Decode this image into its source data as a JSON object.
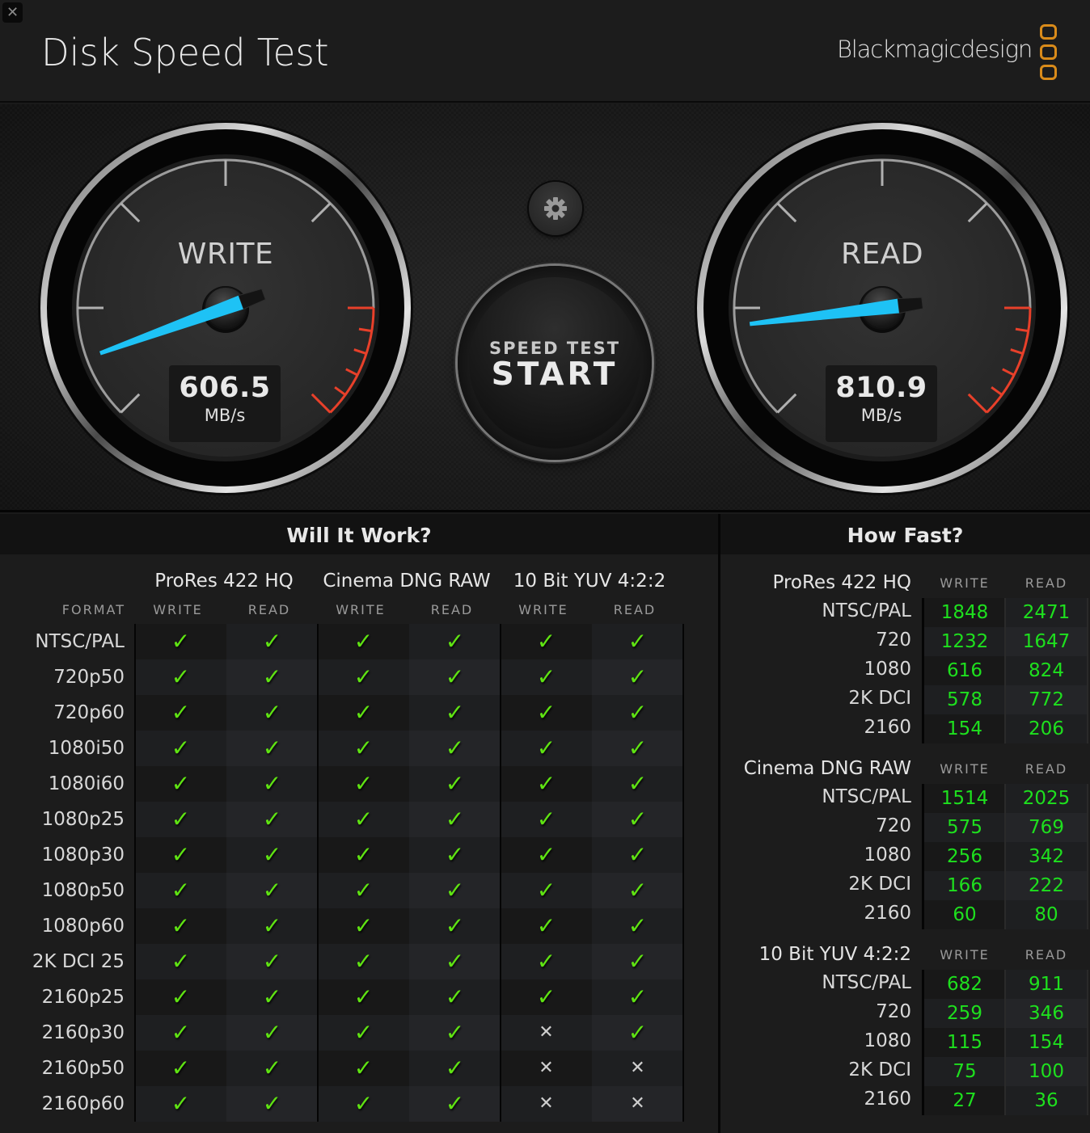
{
  "window": {
    "close_icon": "✕"
  },
  "header": {
    "title": "Disk Speed Test",
    "brand": "Blackmagicdesign"
  },
  "gauges": {
    "write": {
      "label": "WRITE",
      "value": "606.5",
      "unit": "MB/s",
      "needle_fraction": 0.2
    },
    "read": {
      "label": "READ",
      "value": "810.9",
      "unit": "MB/s",
      "needle_fraction": 0.235
    }
  },
  "controls": {
    "settings_icon": "gear-icon",
    "start_line1": "SPEED TEST",
    "start_line2": "START"
  },
  "will_it_work": {
    "title": "Will It Work?",
    "format_header": "FORMAT",
    "codecs": [
      "ProRes 422 HQ",
      "Cinema DNG RAW",
      "10 Bit YUV 4:2:2"
    ],
    "col_labels": [
      "WRITE",
      "READ",
      "WRITE",
      "READ",
      "WRITE",
      "READ"
    ],
    "rows": [
      {
        "format": "NTSC/PAL",
        "results": [
          true,
          true,
          true,
          true,
          true,
          true
        ]
      },
      {
        "format": "720p50",
        "results": [
          true,
          true,
          true,
          true,
          true,
          true
        ]
      },
      {
        "format": "720p60",
        "results": [
          true,
          true,
          true,
          true,
          true,
          true
        ]
      },
      {
        "format": "1080i50",
        "results": [
          true,
          true,
          true,
          true,
          true,
          true
        ]
      },
      {
        "format": "1080i60",
        "results": [
          true,
          true,
          true,
          true,
          true,
          true
        ]
      },
      {
        "format": "1080p25",
        "results": [
          true,
          true,
          true,
          true,
          true,
          true
        ]
      },
      {
        "format": "1080p30",
        "results": [
          true,
          true,
          true,
          true,
          true,
          true
        ]
      },
      {
        "format": "1080p50",
        "results": [
          true,
          true,
          true,
          true,
          true,
          true
        ]
      },
      {
        "format": "1080p60",
        "results": [
          true,
          true,
          true,
          true,
          true,
          true
        ]
      },
      {
        "format": "2K DCI 25",
        "results": [
          true,
          true,
          true,
          true,
          true,
          true
        ]
      },
      {
        "format": "2160p25",
        "results": [
          true,
          true,
          true,
          true,
          true,
          true
        ]
      },
      {
        "format": "2160p30",
        "results": [
          true,
          true,
          true,
          true,
          false,
          true
        ]
      },
      {
        "format": "2160p50",
        "results": [
          true,
          true,
          true,
          true,
          false,
          false
        ]
      },
      {
        "format": "2160p60",
        "results": [
          true,
          true,
          true,
          true,
          false,
          false
        ]
      }
    ],
    "check_glyph": "✓",
    "cross_glyph": "✕"
  },
  "how_fast": {
    "title": "How Fast?",
    "write_label": "WRITE",
    "read_label": "READ",
    "groups": [
      {
        "codec": "ProRes 422 HQ",
        "rows": [
          {
            "format": "NTSC/PAL",
            "write": "1848",
            "read": "2471"
          },
          {
            "format": "720",
            "write": "1232",
            "read": "1647"
          },
          {
            "format": "1080",
            "write": "616",
            "read": "824"
          },
          {
            "format": "2K DCI",
            "write": "578",
            "read": "772"
          },
          {
            "format": "2160",
            "write": "154",
            "read": "206"
          }
        ]
      },
      {
        "codec": "Cinema DNG RAW",
        "rows": [
          {
            "format": "NTSC/PAL",
            "write": "1514",
            "read": "2025"
          },
          {
            "format": "720",
            "write": "575",
            "read": "769"
          },
          {
            "format": "1080",
            "write": "256",
            "read": "342"
          },
          {
            "format": "2K DCI",
            "write": "166",
            "read": "222"
          },
          {
            "format": "2160",
            "write": "60",
            "read": "80"
          }
        ]
      },
      {
        "codec": "10 Bit YUV 4:2:2",
        "rows": [
          {
            "format": "NTSC/PAL",
            "write": "682",
            "read": "911"
          },
          {
            "format": "720",
            "write": "259",
            "read": "346"
          },
          {
            "format": "1080",
            "write": "115",
            "read": "154"
          },
          {
            "format": "2K DCI",
            "write": "75",
            "read": "100"
          },
          {
            "format": "2160",
            "write": "27",
            "read": "36"
          }
        ]
      }
    ]
  },
  "colors": {
    "needle": "#1ec2f5",
    "redline": "#e8402a",
    "check": "#5fe312",
    "speed_value": "#1ee01e",
    "brand_accent": "#d98b1a"
  }
}
